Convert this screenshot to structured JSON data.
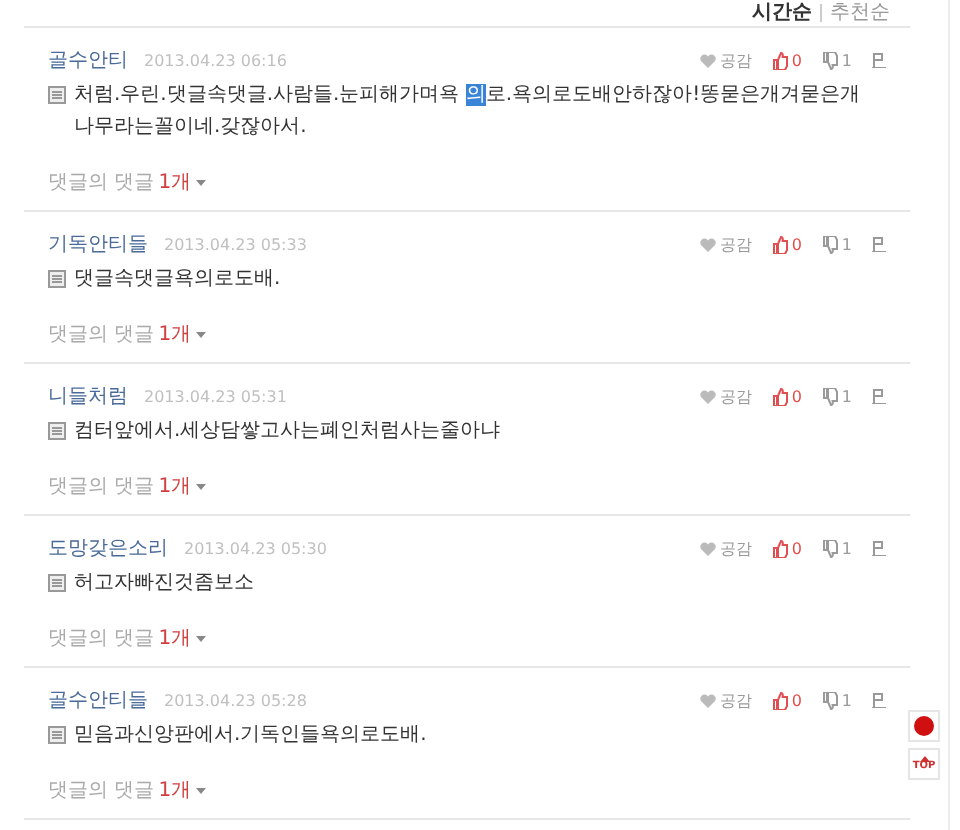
{
  "sort_tabs": [
    {
      "label": "시간순",
      "selected": true
    },
    {
      "label": "추천순",
      "selected": false
    }
  ],
  "comments": [
    {
      "author": "골수안티",
      "date": "2013.04.23 06:16",
      "body": [
        {
          "text": "처럼.우린.댓글속댓글.사람들.눈피해가며욕 ",
          "selected": false
        },
        {
          "text": "의",
          "selected": true
        },
        {
          "text": "로.욕의로도배안하잖아!똥묻은개겨묻은개 나무라는꼴이네.갖잖아서.",
          "selected": false
        }
      ],
      "empathy": "공감",
      "likes": "0",
      "dislikes": "1",
      "replies_label": "댓글의 댓글",
      "replies_count": "1개"
    },
    {
      "author": "기독안티들",
      "date": "2013.04.23 05:33",
      "body": [
        {
          "text": "댓글속댓글욕의로도배.",
          "selected": false
        }
      ],
      "empathy": "공감",
      "likes": "0",
      "dislikes": "1",
      "replies_label": "댓글의 댓글",
      "replies_count": "1개"
    },
    {
      "author": "니들처럼",
      "date": "2013.04.23 05:31",
      "body": [
        {
          "text": "컴터앞에서.세상담쌓고사는폐인처럼사는줄아냐",
          "selected": false
        }
      ],
      "empathy": "공감",
      "likes": "0",
      "dislikes": "1",
      "replies_label": "댓글의 댓글",
      "replies_count": "1개"
    },
    {
      "author": "도망갖은소리",
      "date": "2013.04.23 05:30",
      "body": [
        {
          "text": "허고자빠진것좀보소",
          "selected": false
        }
      ],
      "empathy": "공감",
      "likes": "0",
      "dislikes": "1",
      "replies_label": "댓글의 댓글",
      "replies_count": "1개"
    },
    {
      "author": "골수안티들",
      "date": "2013.04.23 05:28",
      "body": [
        {
          "text": "믿음과신앙판에서.기독인들욕의로도배.",
          "selected": false
        }
      ],
      "empathy": "공감",
      "likes": "0",
      "dislikes": "1",
      "replies_label": "댓글의 댓글",
      "replies_count": "1개"
    }
  ],
  "top_button": {
    "label": "TOP"
  }
}
